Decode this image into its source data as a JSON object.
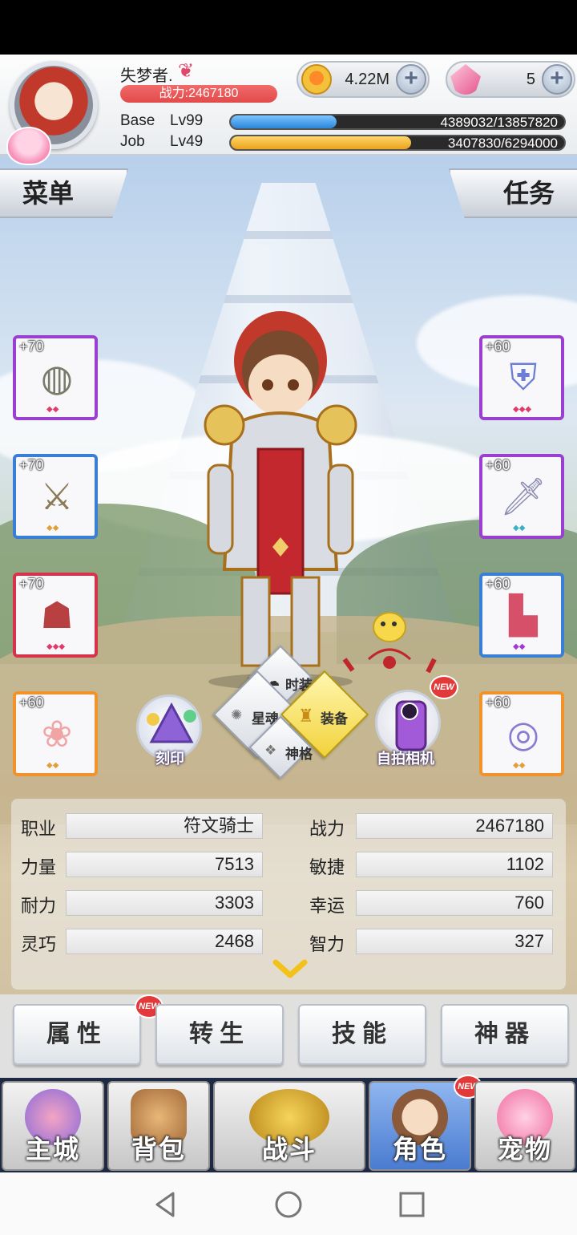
{
  "player": {
    "name": "失梦者.",
    "power_text": "战力:2467180"
  },
  "currency": {
    "gold": "4.22M",
    "gems": "5"
  },
  "levels": {
    "base_label": "Base",
    "base_level": "Lv99",
    "base_exp": "4389032/13857820",
    "base_progress": 0.317,
    "job_label": "Job",
    "job_level": "Lv49",
    "job_exp": "3407830/6294000",
    "job_progress": 0.541
  },
  "side_tabs": {
    "menu": "菜单",
    "task": "任务"
  },
  "equipment": {
    "left": [
      {
        "plus": "+70",
        "icon": "ring-icon"
      },
      {
        "plus": "+70",
        "icon": "sword-icon"
      },
      {
        "plus": "+70",
        "icon": "hood-icon"
      },
      {
        "plus": "+60",
        "icon": "scarf-icon"
      }
    ],
    "right": [
      {
        "plus": "+60",
        "icon": "armor-icon"
      },
      {
        "plus": "+60",
        "icon": "dagger-icon"
      },
      {
        "plus": "+60",
        "icon": "boots-icon"
      },
      {
        "plus": "+60",
        "icon": "bracelet-icon"
      }
    ]
  },
  "center_nav": {
    "fashion": "时装",
    "star_soul": "星魂",
    "equip": "装备",
    "divinity": "神格",
    "engrave": "刻印",
    "selfie_camera": "自拍相机",
    "new_badge": "NEW"
  },
  "stats": {
    "rows": [
      {
        "l_label": "职业",
        "l_value": "符文骑士",
        "r_label": "战力",
        "r_value": "2467180"
      },
      {
        "l_label": "力量",
        "l_value": "7513",
        "r_label": "敏捷",
        "r_value": "1102"
      },
      {
        "l_label": "耐力",
        "l_value": "3303",
        "r_label": "幸运",
        "r_value": "760"
      },
      {
        "l_label": "灵巧",
        "l_value": "2468",
        "r_label": "智力",
        "r_value": "327"
      }
    ]
  },
  "actions": {
    "attributes": "属性",
    "rebirth": "转生",
    "skills": "技能",
    "artifact": "神器",
    "new_badge": "NEW"
  },
  "bottom_nav": {
    "city": "主城",
    "bag": "背包",
    "battle": "战斗",
    "character": "角色",
    "pet": "宠物",
    "new_badge": "NEW"
  },
  "colors": {
    "base_bar": "#3d9be9",
    "job_bar": "#f5b730",
    "slot_purple": "#9b3fd0",
    "slot_blue": "#3a7fd6",
    "slot_red": "#d8324a",
    "slot_orange": "#f1922a"
  }
}
